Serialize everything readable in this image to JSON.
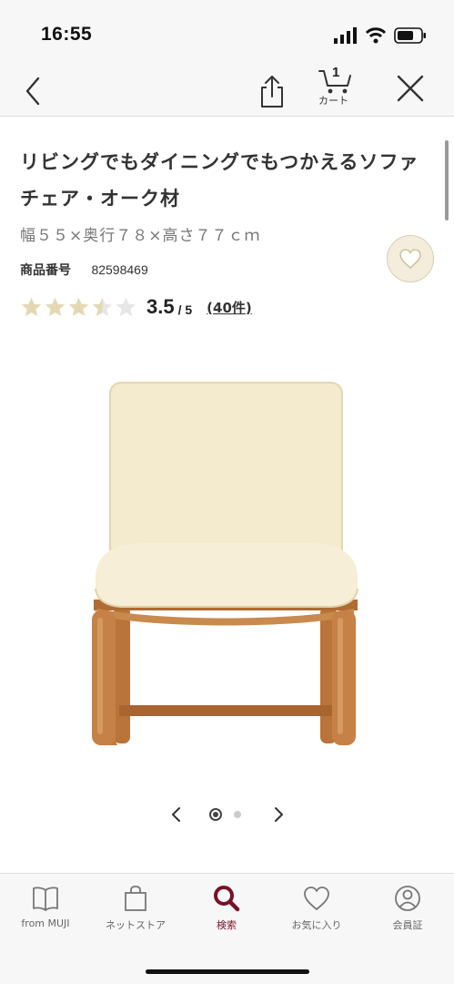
{
  "status_bar": {
    "time": "16:55"
  },
  "nav": {
    "back_icon": "chevron-left-icon",
    "share_icon": "share-icon",
    "cart_icon": "cart-icon",
    "cart_count": "1",
    "cart_label": "カート",
    "close_icon": "close-icon"
  },
  "product": {
    "title": "リビングでもダイニングでもつかえるソファチェア・オーク材",
    "size": "幅５５×奥行７８×高さ７７ｃｍ",
    "number_label": "商品番号",
    "number": "82598469",
    "rating": {
      "stars": 3.5,
      "value": "3.5",
      "max": "/ 5",
      "count": "(40件)"
    },
    "favorite_icon": "heart-icon"
  },
  "carousel": {
    "current": 1,
    "total": 2
  },
  "tabs": [
    {
      "label": "from MUJI",
      "icon": "book-icon"
    },
    {
      "label": "ネットストア",
      "icon": "bag-icon"
    },
    {
      "label": "検索",
      "icon": "search-icon"
    },
    {
      "label": "お気に入り",
      "icon": "heart-icon"
    },
    {
      "label": "会員証",
      "icon": "member-icon"
    }
  ],
  "colors": {
    "accent": "#7a1028",
    "star": "#e4d8b4",
    "star_empty": "#e6e6e6",
    "favorite_bg": "#f4eddc"
  }
}
